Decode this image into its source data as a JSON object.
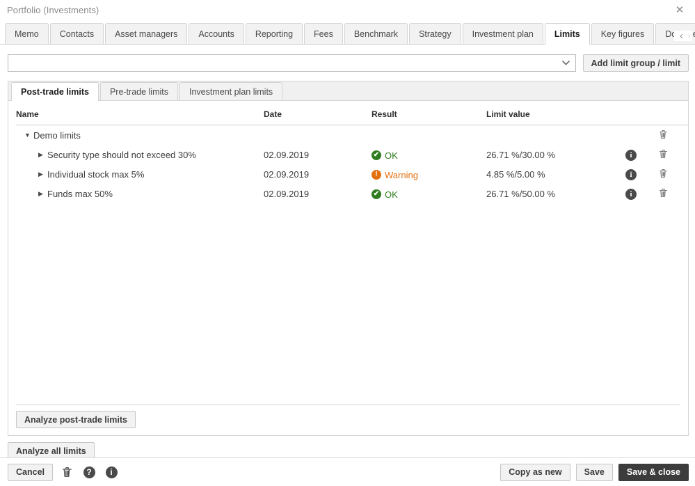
{
  "window": {
    "title": "Portfolio (Investments)",
    "close_label": "✕"
  },
  "main_tabs": {
    "items": [
      {
        "label": "Memo",
        "active": false
      },
      {
        "label": "Contacts",
        "active": false
      },
      {
        "label": "Asset managers",
        "active": false
      },
      {
        "label": "Accounts",
        "active": false
      },
      {
        "label": "Reporting",
        "active": false
      },
      {
        "label": "Fees",
        "active": false
      },
      {
        "label": "Benchmark",
        "active": false
      },
      {
        "label": "Strategy",
        "active": false
      },
      {
        "label": "Investment plan",
        "active": false
      },
      {
        "label": "Limits",
        "active": true
      },
      {
        "label": "Key figures",
        "active": false
      },
      {
        "label": "Documents",
        "active": false
      }
    ],
    "prev_label": "‹",
    "next_label": "›"
  },
  "toolbar": {
    "combo_value": "",
    "combo_placeholder": "",
    "combo_arrow": "⌄",
    "add_limit_label": "Add limit group / limit"
  },
  "sub_tabs": {
    "items": [
      {
        "label": "Post-trade limits",
        "active": true
      },
      {
        "label": "Pre-trade limits",
        "active": false
      },
      {
        "label": "Investment plan limits",
        "active": false
      }
    ]
  },
  "table": {
    "columns": [
      "Name",
      "Date",
      "Result",
      "Limit value"
    ],
    "group_row": {
      "name": "Demo limits",
      "twisty": "▼",
      "date": "",
      "result_label": "",
      "limit_value": ""
    },
    "rows": [
      {
        "twisty": "▶",
        "name": "Security type should not exceed 30%",
        "date": "02.09.2019",
        "result_label": "OK",
        "result_status": "ok",
        "result_glyph": "✔",
        "limit_value": "26.71 %/30.00 %"
      },
      {
        "twisty": "▶",
        "name": "Individual stock max 5%",
        "date": "02.09.2019",
        "result_label": "Warning",
        "result_status": "warn",
        "result_glyph": "!",
        "limit_value": "4.85 %/5.00 %"
      },
      {
        "twisty": "▶",
        "name": "Funds max 50%",
        "date": "02.09.2019",
        "result_label": "OK",
        "result_status": "ok",
        "result_glyph": "✔",
        "limit_value": "26.71 %/50.00 %"
      }
    ],
    "info_glyph": "i",
    "delete_glyph": "🗑"
  },
  "panel_footer": {
    "analyze_post_trade_label": "Analyze post-trade limits"
  },
  "outer_actions": {
    "analyze_all_label": "Analyze all limits"
  },
  "bottom_bar": {
    "cancel_label": "Cancel",
    "delete_glyph": "🗑",
    "help_glyph": "?",
    "info_glyph": "i",
    "copy_as_new_label": "Copy as new",
    "save_label": "Save",
    "save_close_label": "Save & close"
  },
  "colors": {
    "ok": "#2f7d1f",
    "warning": "#e2700f",
    "primary_button": "#3c3c3c"
  }
}
